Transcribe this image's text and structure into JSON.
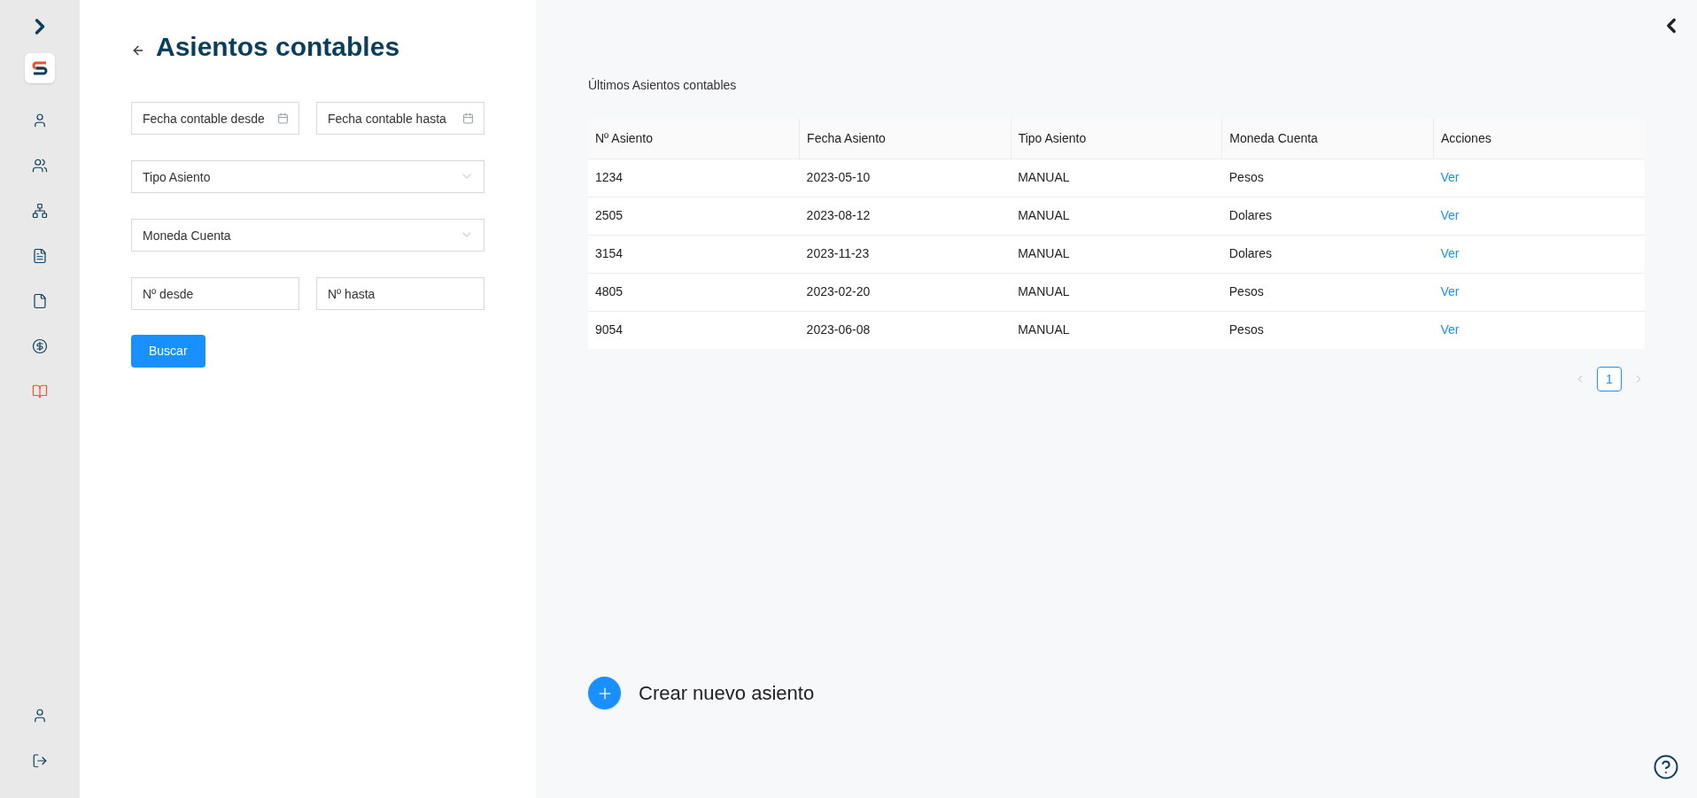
{
  "sidebar": {
    "items": [
      {
        "selected": false
      },
      {
        "selected": false
      },
      {
        "selected": false
      },
      {
        "selected": false
      },
      {
        "selected": false
      },
      {
        "selected": false
      },
      {
        "selected": true
      }
    ]
  },
  "page": {
    "title": "Asientos contables"
  },
  "filters": [
    [
      {
        "kind": "date",
        "placeholder": "Fecha contable desde"
      },
      {
        "kind": "date",
        "placeholder": "Fecha contable hasta"
      }
    ],
    [
      {
        "kind": "select",
        "placeholder": "Tipo Asiento"
      }
    ],
    [
      {
        "kind": "select",
        "placeholder": "Moneda Cuenta"
      }
    ],
    [
      {
        "kind": "text",
        "placeholder": "Nº desde"
      },
      {
        "kind": "text",
        "placeholder": "Nº hasta"
      }
    ]
  ],
  "search_button": "Buscar",
  "table": {
    "title": "Últimos Asientos contables",
    "columns": [
      "Nº Asiento",
      "Fecha Asiento",
      "Tipo Asiento",
      "Moneda Cuenta",
      "Acciones"
    ],
    "rows": [
      [
        "1234",
        "2023-05-10",
        "MANUAL",
        "Pesos",
        "Ver"
      ],
      [
        "2505",
        "2023-08-12",
        "MANUAL",
        "Dolares",
        "Ver"
      ],
      [
        "3154",
        "2023-11-23",
        "MANUAL",
        "Dolares",
        "Ver"
      ],
      [
        "4805",
        "2023-02-20",
        "MANUAL",
        "Pesos",
        "Ver"
      ],
      [
        "9054",
        "2023-06-08",
        "MANUAL",
        "Pesos",
        "Ver"
      ]
    ]
  },
  "pagination": {
    "pages": [
      {
        "label": "1",
        "selected": true
      }
    ]
  },
  "create_button": "Crear nuevo asiento"
}
